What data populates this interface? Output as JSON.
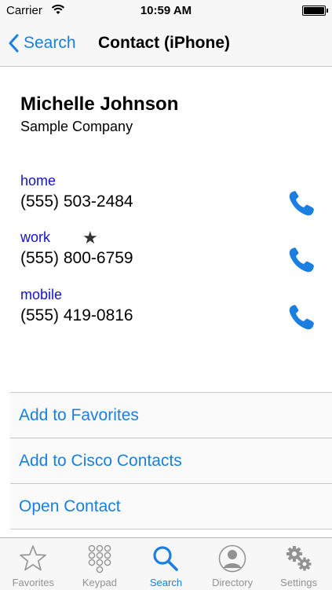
{
  "status_bar": {
    "carrier": "Carrier",
    "time": "10:59 AM",
    "battery_level": 1.0
  },
  "nav": {
    "back_label": "Search",
    "title": "Contact (iPhone)"
  },
  "contact": {
    "name": "Michelle Johnson",
    "company": "Sample Company",
    "phones": [
      {
        "label": "home",
        "number": "(555) 503-2484",
        "favorite": false
      },
      {
        "label": "work",
        "number": "(555) 800-6759",
        "favorite": true
      },
      {
        "label": "mobile",
        "number": "(555) 419-0816",
        "favorite": false
      }
    ]
  },
  "actions": [
    {
      "label": "Add to Favorites"
    },
    {
      "label": "Add to Cisco Contacts"
    },
    {
      "label": "Open Contact"
    }
  ],
  "tabs": [
    {
      "label": "Favorites",
      "icon": "star-outline-icon",
      "active": false
    },
    {
      "label": "Keypad",
      "icon": "keypad-icon",
      "active": false
    },
    {
      "label": "Search",
      "icon": "search-icon",
      "active": true
    },
    {
      "label": "Directory",
      "icon": "person-icon",
      "active": false
    },
    {
      "label": "Settings",
      "icon": "gear-icon",
      "active": false
    }
  ],
  "colors": {
    "accent": "#1a7fe0",
    "phone_label": "#1212c8",
    "inactive_tab": "#929292",
    "bar_background": "#f7f7f7"
  }
}
